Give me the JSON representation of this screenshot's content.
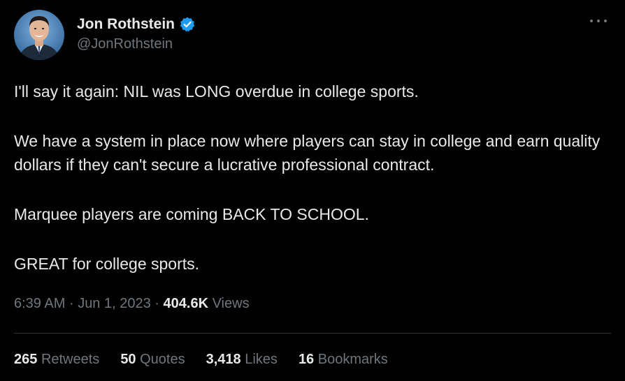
{
  "author": {
    "display_name": "Jon Rothstein",
    "handle": "@JonRothstein",
    "verified": true,
    "avatar_icon": "profile-photo",
    "verified_icon": "verified-badge-icon"
  },
  "tweet": {
    "paragraphs": [
      "I'll say it again: NIL was LONG overdue in college sports.",
      "We have a system in place now where players can stay in college and earn quality dollars if they can't secure a lucrative professional contract.",
      "Marquee players are coming BACK TO SCHOOL.",
      "GREAT for college sports."
    ],
    "time": "6:39 AM",
    "date": "Jun 1, 2023",
    "views_count": "404.6K",
    "views_label": "Views",
    "separator": "·"
  },
  "stats": {
    "retweets": {
      "count": "265",
      "label": "Retweets"
    },
    "quotes": {
      "count": "50",
      "label": "Quotes"
    },
    "likes": {
      "count": "3,418",
      "label": "Likes"
    },
    "bookmarks": {
      "count": "16",
      "label": "Bookmarks"
    }
  },
  "colors": {
    "background": "#000000",
    "text_primary": "#e7e9ea",
    "text_secondary": "#71767b",
    "verified_blue": "#1d9bf0",
    "divider": "#2f3336"
  }
}
